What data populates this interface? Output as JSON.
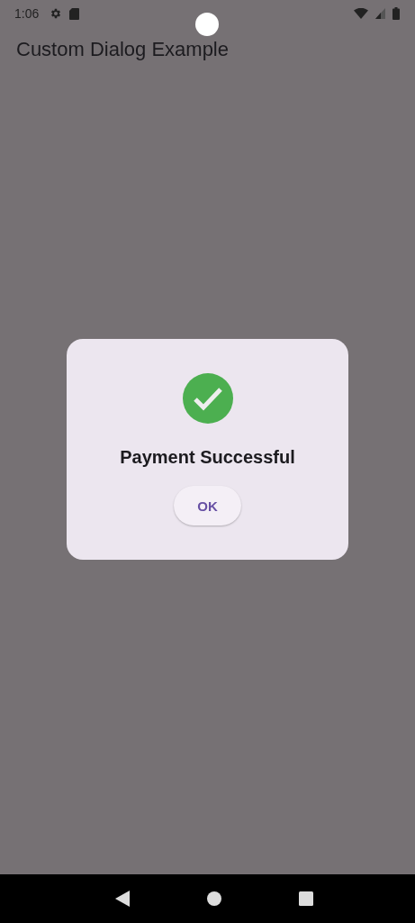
{
  "status_bar": {
    "time": "1:06"
  },
  "app_bar": {
    "title": "Custom Dialog Example"
  },
  "dialog": {
    "title": "Payment Successful",
    "buttons": [
      "OK"
    ]
  }
}
